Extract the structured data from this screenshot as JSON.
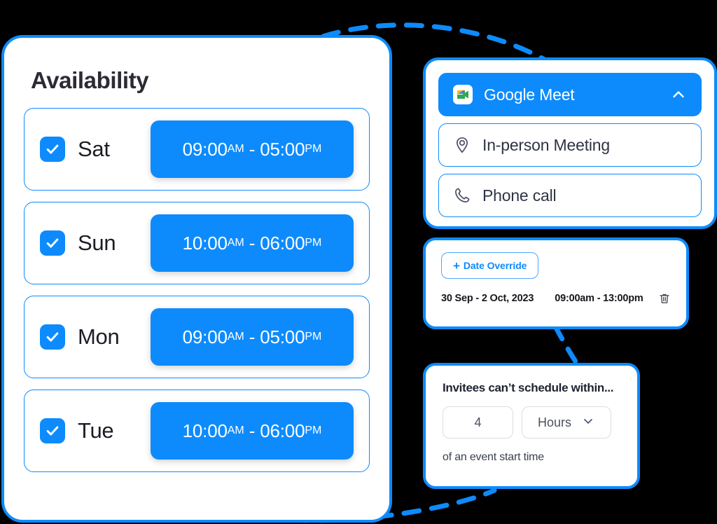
{
  "accent_color": "#0d8bfd",
  "background_color": "#000000",
  "availability": {
    "title": "Availability",
    "days": [
      {
        "label": "Sat",
        "checked": true,
        "start": "09:00",
        "start_meridiem": "AM",
        "end": "05:00",
        "end_meridiem": "PM",
        "separator": "-"
      },
      {
        "label": "Sun",
        "checked": true,
        "start": "10:00",
        "start_meridiem": "AM",
        "end": "06:00",
        "end_meridiem": "PM",
        "separator": "-"
      },
      {
        "label": "Mon",
        "checked": true,
        "start": "09:00",
        "start_meridiem": "AM",
        "end": "05:00",
        "end_meridiem": "PM",
        "separator": "-"
      },
      {
        "label": "Tue",
        "checked": true,
        "start": "10:00",
        "start_meridiem": "AM",
        "end": "06:00",
        "end_meridiem": "PM",
        "separator": "-"
      }
    ]
  },
  "meeting_type": {
    "options": [
      {
        "label": "Google Meet",
        "icon": "google-meet-icon",
        "selected": true,
        "chevron": "chevron-up-icon"
      },
      {
        "label": "In-person Meeting",
        "icon": "location-pin-icon",
        "selected": false
      },
      {
        "label": "Phone call",
        "icon": "phone-icon",
        "selected": false
      }
    ]
  },
  "date_override": {
    "button_plus": "+",
    "button_label": "Date Override",
    "entry": {
      "date_range": "30 Sep - 2 Oct, 2023",
      "time_range": "09:00am - 13:00pm",
      "delete_icon": "trash-icon"
    }
  },
  "invitees": {
    "heading": "Invitees can’t schedule within...",
    "buffer_value": "4",
    "buffer_placeholder": "4",
    "unit_label": "Hours",
    "unit_chevron": "chevron-down-icon",
    "footnote": "of an event start time"
  }
}
